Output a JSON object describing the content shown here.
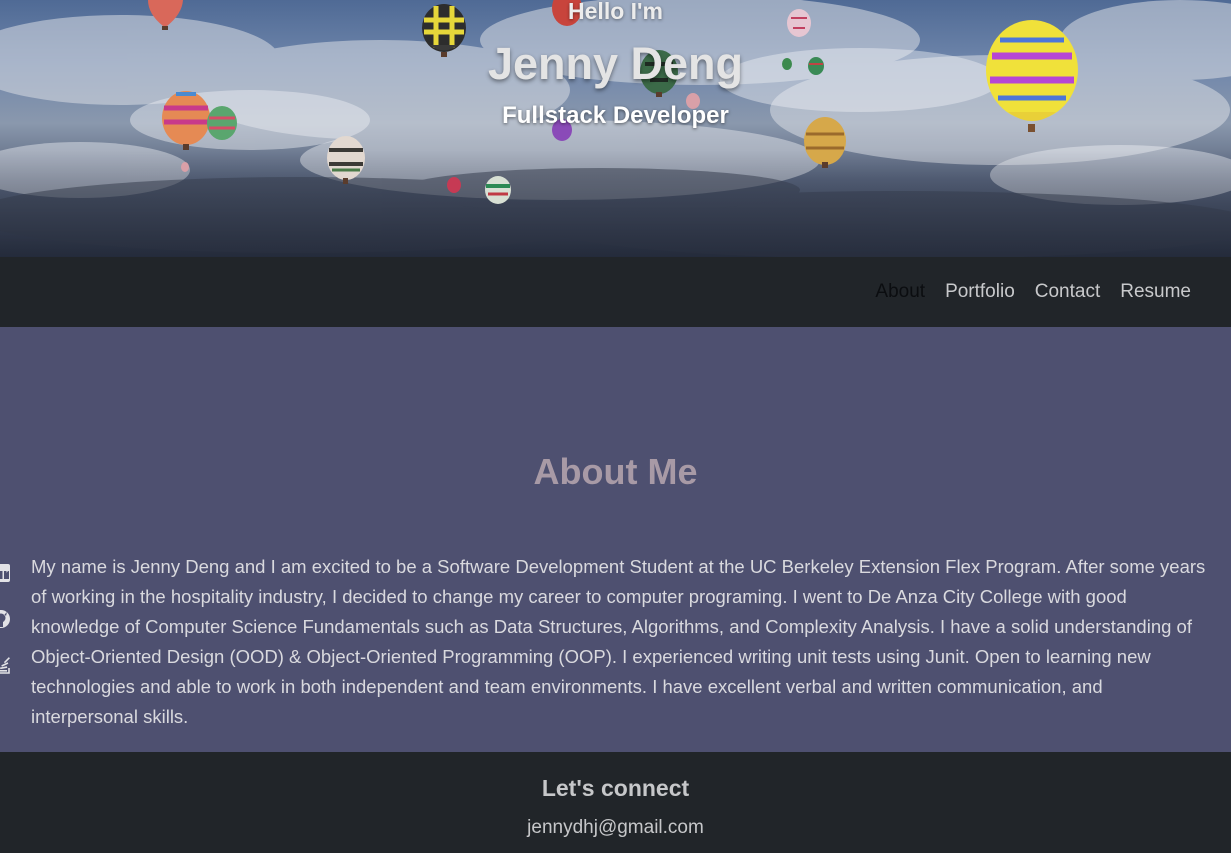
{
  "hero": {
    "greeting": "Hello I'm",
    "name": "Jenny Deng",
    "role": "Fullstack Developer"
  },
  "nav": {
    "items": [
      {
        "label": "About",
        "active": true
      },
      {
        "label": "Portfolio",
        "active": false
      },
      {
        "label": "Contact",
        "active": false
      },
      {
        "label": "Resume",
        "active": false
      }
    ]
  },
  "about": {
    "heading": "About Me",
    "body": "My name is Jenny Deng and I am excited to be a Software Development Student at the UC Berkeley Extension Flex Program. After some years of working in the hospitality industry, I decided to change my career to computer programing. I went to De Anza City College with good knowledge of Computer Science Fundamentals such as Data Structures, Algorithms, and Complexity Analysis. I have a solid understanding of Object-Oriented Design (OOD) & Object-Oriented Programming (OOP). I experienced writing unit tests using Junit. Open to learning new technologies and able to work in both independent and team environments. I have excellent verbal and written communication, and interpersonal skills.",
    "social_icons": [
      "linkedin-icon",
      "github-icon",
      "stack-overflow-icon"
    ]
  },
  "footer": {
    "heading": "Let's connect",
    "email": "jennydhj@gmail.com"
  },
  "colors": {
    "nav_bg": "#212529",
    "about_bg": "#4e5070",
    "heading": "#a89aa6",
    "body_text": "#d9d9de",
    "footer_text": "#c6c7c9"
  }
}
